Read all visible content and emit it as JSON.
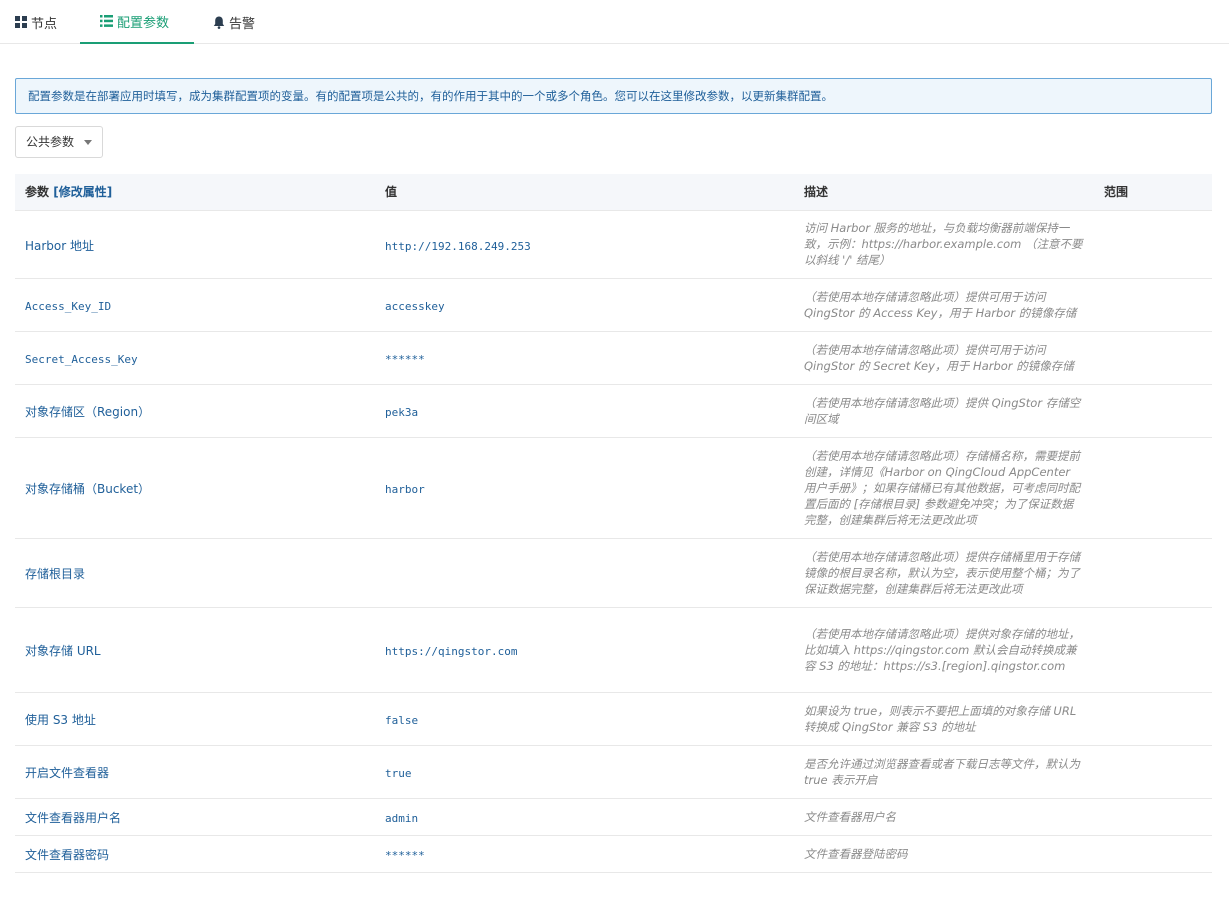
{
  "tabs": [
    {
      "label": "节点",
      "icon": "grid-icon",
      "active": false
    },
    {
      "label": "配置参数",
      "icon": "list-icon",
      "active": true
    },
    {
      "label": "告警",
      "icon": "bell-icon",
      "active": false
    }
  ],
  "notice": {
    "text": "配置参数是在部署应用时填写，成为集群配置项的变量。有的配置项是公共的，有的作用于其中的一个或多个角色。您可以在这里修改参数，以更新集群配置。"
  },
  "select": {
    "value": "公共参数"
  },
  "table": {
    "headers": {
      "name": "参数",
      "edit_link": "[修改属性]",
      "value": "值",
      "desc": "描述",
      "scope": "范围"
    },
    "rows": [
      {
        "name": "Harbor 地址",
        "value": "http://192.168.249.253",
        "desc": "访问 Harbor 服务的地址，与负载均衡器前端保持一致，示例：https://harbor.example.com （注意不要以斜线 '/' 结尾）",
        "h": 68,
        "mono": false
      },
      {
        "name": "Access_Key_ID",
        "value": "accesskey",
        "desc": "（若使用本地存储请忽略此项）提供可用于访问 QingStor 的 Access Key，用于 Harbor 的镜像存储",
        "h": 53,
        "mono": true
      },
      {
        "name": "Secret_Access_Key",
        "value": "******",
        "desc": "（若使用本地存储请忽略此项）提供可用于访问 QingStor 的 Secret Key，用于 Harbor 的镜像存储",
        "h": 53,
        "mono": true
      },
      {
        "name": "对象存储区（Region）",
        "value": "pek3a",
        "desc": "（若使用本地存储请忽略此项）提供 QingStor 存储空间区域",
        "h": 53,
        "mono": false
      },
      {
        "name": "对象存储桶（Bucket）",
        "value": "harbor",
        "desc": "（若使用本地存储请忽略此项）存储桶名称，需要提前创建，详情见《Harbor on QingCloud AppCenter 用户手册》；如果存储桶已有其他数据，可考虑同时配置后面的 [存储根目录] 参数避免冲突；为了保证数据完整，创建集群后将无法更改此项",
        "h": 101,
        "mono": false
      },
      {
        "name": "存储根目录",
        "value": "",
        "desc": "（若使用本地存储请忽略此项）提供存储桶里用于存储镜像的根目录名称，默认为空，表示使用整个桶；为了保证数据完整，创建集群后将无法更改此项",
        "h": 69,
        "mono": false
      },
      {
        "name": "对象存储 URL",
        "value": "https://qingstor.com",
        "desc": "（若使用本地存储请忽略此项）提供对象存储的地址，比如填入 https://qingstor.com 默认会自动转换成兼容 S3 的地址：https://s3.[region].qingstor.com",
        "h": 85,
        "mono": false
      },
      {
        "name": "使用 S3 地址",
        "value": "false",
        "desc": "如果设为 true，则表示不要把上面填的对象存储 URL 转换成 QingStor 兼容 S3 的地址",
        "h": 53,
        "mono": false
      },
      {
        "name": "开启文件查看器",
        "value": "true",
        "desc": "是否允许通过浏览器查看或者下载日志等文件，默认为 true 表示开启",
        "h": 53,
        "mono": false
      },
      {
        "name": "文件查看器用户名",
        "value": "admin",
        "desc": "文件查看器用户名",
        "h": 37,
        "mono": false
      },
      {
        "name": "文件查看器密码",
        "value": "******",
        "desc": "文件查看器登陆密码",
        "h": 37,
        "mono": false
      }
    ]
  },
  "colors": {
    "accent": "#1a9e75",
    "link": "#1f5f99",
    "notice_bg": "#eef6fc",
    "notice_border": "#6aa7d8"
  }
}
